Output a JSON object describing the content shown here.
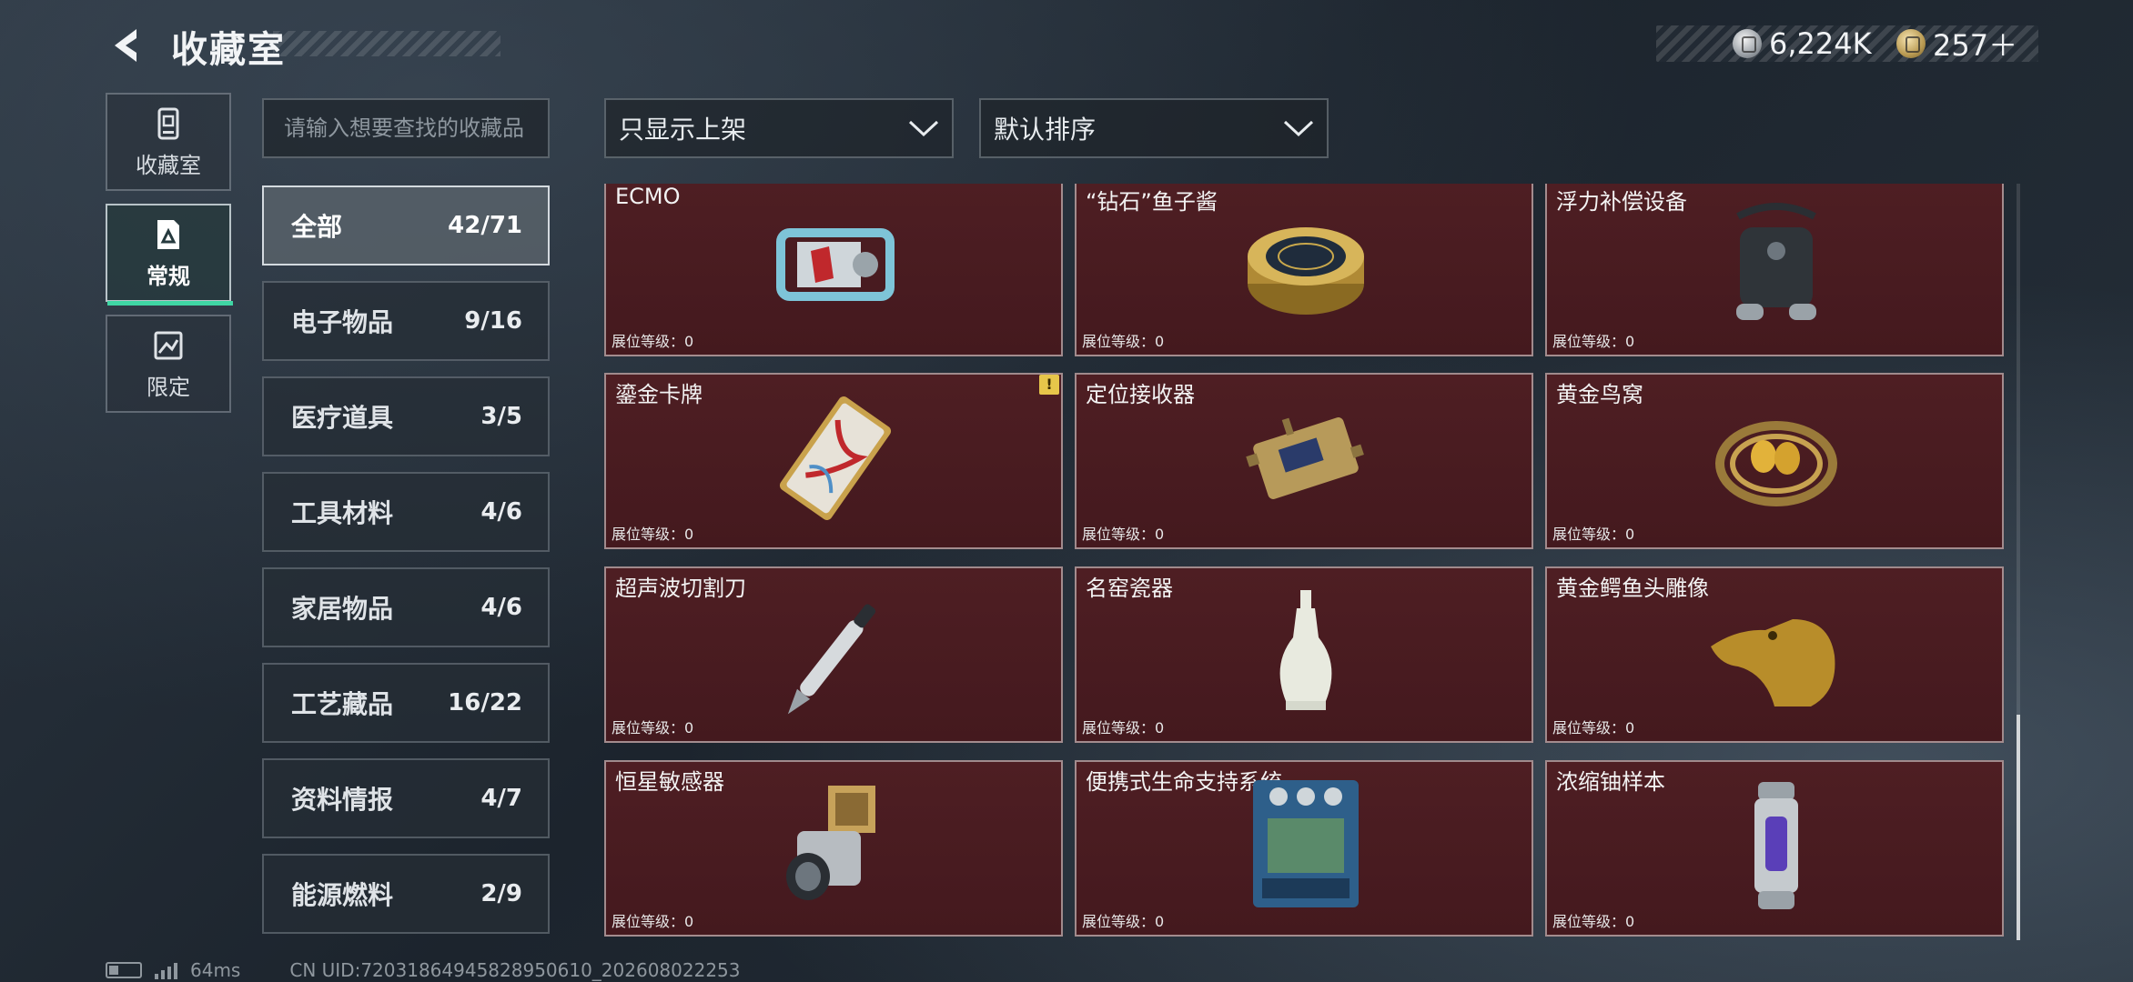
{
  "header": {
    "title": "收藏室",
    "currencies": [
      {
        "icon": "silver-coin-icon",
        "value": "6,224K"
      },
      {
        "icon": "gold-coin-icon",
        "value": "257＋"
      }
    ]
  },
  "side_tabs": [
    {
      "label": "收藏室",
      "icon": "collection-room-icon",
      "active": false
    },
    {
      "label": "常规",
      "icon": "regular-item-icon",
      "active": true
    },
    {
      "label": "限定",
      "icon": "limited-item-icon",
      "active": false
    }
  ],
  "search": {
    "placeholder": "请输入想要查找的收藏品",
    "value": ""
  },
  "filter": {
    "selected": "只显示上架"
  },
  "sort": {
    "selected": "默认排序"
  },
  "categories": [
    {
      "name": "全部",
      "count": "42/71",
      "active": true
    },
    {
      "name": "电子物品",
      "count": "9/16",
      "active": false
    },
    {
      "name": "医疗道具",
      "count": "3/5",
      "active": false
    },
    {
      "name": "工具材料",
      "count": "4/6",
      "active": false
    },
    {
      "name": "家居物品",
      "count": "4/6",
      "active": false
    },
    {
      "name": "工艺藏品",
      "count": "16/22",
      "active": false
    },
    {
      "name": "资料情报",
      "count": "4/7",
      "active": false
    },
    {
      "name": "能源燃料",
      "count": "2/9",
      "active": false
    }
  ],
  "items": [
    {
      "name": "ECMO",
      "level": "展位等级：0",
      "icon": "ecmo-machine-icon",
      "alert": false
    },
    {
      "name": "“钻石”鱼子酱",
      "level": "展位等级：0",
      "icon": "caviar-tin-icon",
      "alert": false
    },
    {
      "name": "浮力补偿设备",
      "level": "展位等级：0",
      "icon": "buoyancy-device-icon",
      "alert": false
    },
    {
      "name": "鎏金卡牌",
      "level": "展位等级：0",
      "icon": "gilded-card-icon",
      "alert": true,
      "alert_text": "!"
    },
    {
      "name": "定位接收器",
      "level": "展位等级：0",
      "icon": "locator-receiver-icon",
      "alert": false
    },
    {
      "name": "黄金鸟窝",
      "level": "展位等级：0",
      "icon": "golden-nest-icon",
      "alert": false
    },
    {
      "name": "超声波切割刀",
      "level": "展位等级：0",
      "icon": "ultrasonic-knife-icon",
      "alert": false
    },
    {
      "name": "名窑瓷器",
      "level": "展位等级：0",
      "icon": "porcelain-vase-icon",
      "alert": false
    },
    {
      "name": "黄金鳄鱼头雕像",
      "level": "展位等级：0",
      "icon": "golden-crocodile-statue-icon",
      "alert": false
    },
    {
      "name": "恒星敏感器",
      "level": "展位等级：0",
      "icon": "star-sensor-icon",
      "alert": false
    },
    {
      "name": "便携式生命支持系统",
      "level": "展位等级：0",
      "icon": "life-support-system-icon",
      "alert": false
    },
    {
      "name": "浓缩铀样本",
      "level": "展位等级：0",
      "icon": "uranium-sample-icon",
      "alert": false
    }
  ],
  "status": {
    "ping": "64ms",
    "uid": "CN UID:72031864945828950610_202608022253"
  },
  "colors": {
    "card_bg": "#4e1e23",
    "active_accent": "#3fd6a4"
  }
}
